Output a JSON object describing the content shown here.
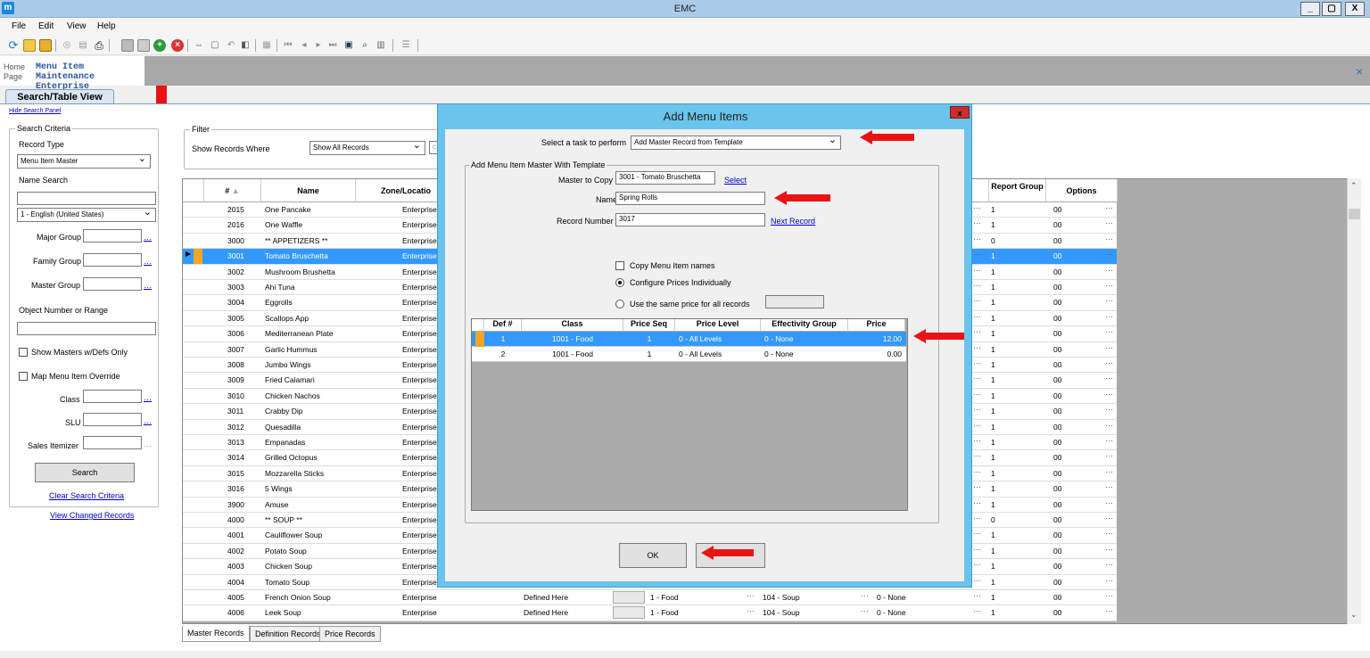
{
  "app": {
    "title": "EMC",
    "icon_letter": "m"
  },
  "window_buttons": [
    "_",
    "▢",
    "X"
  ],
  "menu": [
    "File",
    "Edit",
    "View",
    "Help"
  ],
  "tabs": {
    "home": "Home Page",
    "home_line1": "Home",
    "home_line2": "Page",
    "module_line1": "Menu Item Maintenance",
    "module_line2": "Enterprise",
    "close": "×"
  },
  "view_tab": "Search/Table View",
  "hide_panel": "Hide Search Panel",
  "search": {
    "criteria_label": "Search Criteria",
    "record_type_label": "Record Type",
    "record_type_value": "Menu Item Master",
    "name_search_label": "Name Search",
    "language_value": "1 - English (United States)",
    "major_group": "Major Group",
    "family_group": "Family Group",
    "master_group": "Master Group",
    "object_number": "Object Number or Range",
    "show_masters": "Show Masters w/Defs Only",
    "map_override": "Map Menu Item Override",
    "class": "Class",
    "slu": "SLU",
    "sales_itemizer": "Sales Itemizer",
    "search_button": "Search",
    "clear": "Clear Search Criteria",
    "view_changed": "View Changed Records"
  },
  "filter": {
    "label": "Filter",
    "show_records_where": "Show Records Where",
    "value": "Show All Records",
    "partial": "c"
  },
  "grid": {
    "headers": {
      "num": "#",
      "name": "Name",
      "zone": "Zone/Locatio",
      "report_group": "Report Group",
      "options": "Options"
    },
    "rows": [
      {
        "num": "2015",
        "name": "One Pancake",
        "zone": "Enterprise",
        "rg": "1",
        "opt": "00"
      },
      {
        "num": "2016",
        "name": "One Waffle",
        "zone": "Enterprise",
        "rg": "1",
        "opt": "00"
      },
      {
        "num": "3000",
        "name": "** APPETIZERS **",
        "zone": "Enterprise",
        "rg": "0",
        "opt": "00"
      },
      {
        "num": "3001",
        "name": "Tomato Bruschetta",
        "zone": "Enterprise",
        "rg": "1",
        "opt": "00"
      },
      {
        "num": "3002",
        "name": "Mushroom Brushetta",
        "zone": "Enterprise",
        "rg": "1",
        "opt": "00"
      },
      {
        "num": "3003",
        "name": "Ahi Tuna",
        "zone": "Enterprise",
        "rg": "1",
        "opt": "00"
      },
      {
        "num": "3004",
        "name": "Eggrolls",
        "zone": "Enterprise",
        "rg": "1",
        "opt": "00"
      },
      {
        "num": "3005",
        "name": "Scallops App",
        "zone": "Enterprise",
        "rg": "1",
        "opt": "00"
      },
      {
        "num": "3006",
        "name": "Mediterranean Plate",
        "zone": "Enterprise",
        "rg": "1",
        "opt": "00"
      },
      {
        "num": "3007",
        "name": "Garlic Hummus",
        "zone": "Enterprise",
        "rg": "1",
        "opt": "00"
      },
      {
        "num": "3008",
        "name": "Jumbo Wings",
        "zone": "Enterprise",
        "rg": "1",
        "opt": "00"
      },
      {
        "num": "3009",
        "name": "Fried Calamari",
        "zone": "Enterprise",
        "rg": "1",
        "opt": "00"
      },
      {
        "num": "3010",
        "name": "Chicken Nachos",
        "zone": "Enterprise",
        "rg": "1",
        "opt": "00"
      },
      {
        "num": "3011",
        "name": "Crabby Dip",
        "zone": "Enterprise",
        "rg": "1",
        "opt": "00"
      },
      {
        "num": "3012",
        "name": "Quesadilla",
        "zone": "Enterprise",
        "rg": "1",
        "opt": "00"
      },
      {
        "num": "3013",
        "name": "Empanadas",
        "zone": "Enterprise",
        "rg": "1",
        "opt": "00"
      },
      {
        "num": "3014",
        "name": "Grilled Octopus",
        "zone": "Enterprise",
        "rg": "1",
        "opt": "00"
      },
      {
        "num": "3015",
        "name": "Mozzarella Sticks",
        "zone": "Enterprise",
        "rg": "1",
        "opt": "00"
      },
      {
        "num": "3016",
        "name": "5 Wings",
        "zone": "Enterprise",
        "rg": "1",
        "opt": "00"
      },
      {
        "num": "3900",
        "name": "Amuse",
        "zone": "Enterprise",
        "rg": "1",
        "opt": "00"
      },
      {
        "num": "4000",
        "name": "** SOUP **",
        "zone": "Enterprise",
        "rg": "0",
        "opt": "00"
      },
      {
        "num": "4001",
        "name": "Cauliflower Soup",
        "zone": "Enterprise",
        "rg": "1",
        "opt": "00"
      },
      {
        "num": "4002",
        "name": "Potato Soup",
        "zone": "Enterprise",
        "rg": "1",
        "opt": "00"
      },
      {
        "num": "4003",
        "name": "Chicken Soup",
        "zone": "Enterprise",
        "rg": "1",
        "opt": "00"
      },
      {
        "num": "4004",
        "name": "Tomato Soup",
        "zone": "Enterprise",
        "rg": "1",
        "opt": "00"
      },
      {
        "num": "4005",
        "name": "French Onion Soup",
        "zone": "Enterprise",
        "rg": "1",
        "opt": "00",
        "def": "Defined Here",
        "cls": "1 - Food",
        "sub": "104 - Soup",
        "eff": "0 - None"
      },
      {
        "num": "4006",
        "name": "Leek Soup",
        "zone": "Enterprise",
        "rg": "1",
        "opt": "00",
        "def": "Defined Here",
        "cls": "1 - Food",
        "sub": "104 - Soup",
        "eff": "0 - None"
      }
    ],
    "bottom_tabs": [
      "Master Records",
      "Definition Records",
      "Price Records"
    ]
  },
  "dialog": {
    "title": "Add Menu Items",
    "close": "x",
    "task_label": "Select a task to perform",
    "task_value": "Add Master Record from Template",
    "group_label": "Add Menu Item Master With Template",
    "master_to_copy_label": "Master to Copy",
    "master_to_copy_value": "3001 - Tomato Bruschetta",
    "select_link": "Select",
    "name_label": "Name",
    "name_value": "Spring Rolls",
    "record_number_label": "Record Number",
    "record_number_value": "3017",
    "next_record": "Next Record",
    "copy_names": "Copy Menu Item names",
    "configure_individually": "Configure Prices Individually",
    "same_price": "Use the same price for all records",
    "price_headers": {
      "def": "Def #",
      "class": "Class",
      "seq": "Price Seq",
      "level": "Price Level",
      "eff": "Effectivity Group",
      "price": "Price"
    },
    "price_rows": [
      {
        "def": "1",
        "class": "1001 - Food",
        "seq": "1",
        "level": "0 - All Levels",
        "eff": "0 - None",
        "price": "12.00"
      },
      {
        "def": "2",
        "class": "1001 - Food",
        "seq": "1",
        "level": "0 - All Levels",
        "eff": "0 - None",
        "price": "0.00"
      }
    ],
    "ok": "OK"
  },
  "colors": {
    "selection": "#3399ff",
    "dialog_frame": "#6bc4eb",
    "annotation_arrow": "#e81414",
    "title_bar": "#aacbea"
  }
}
